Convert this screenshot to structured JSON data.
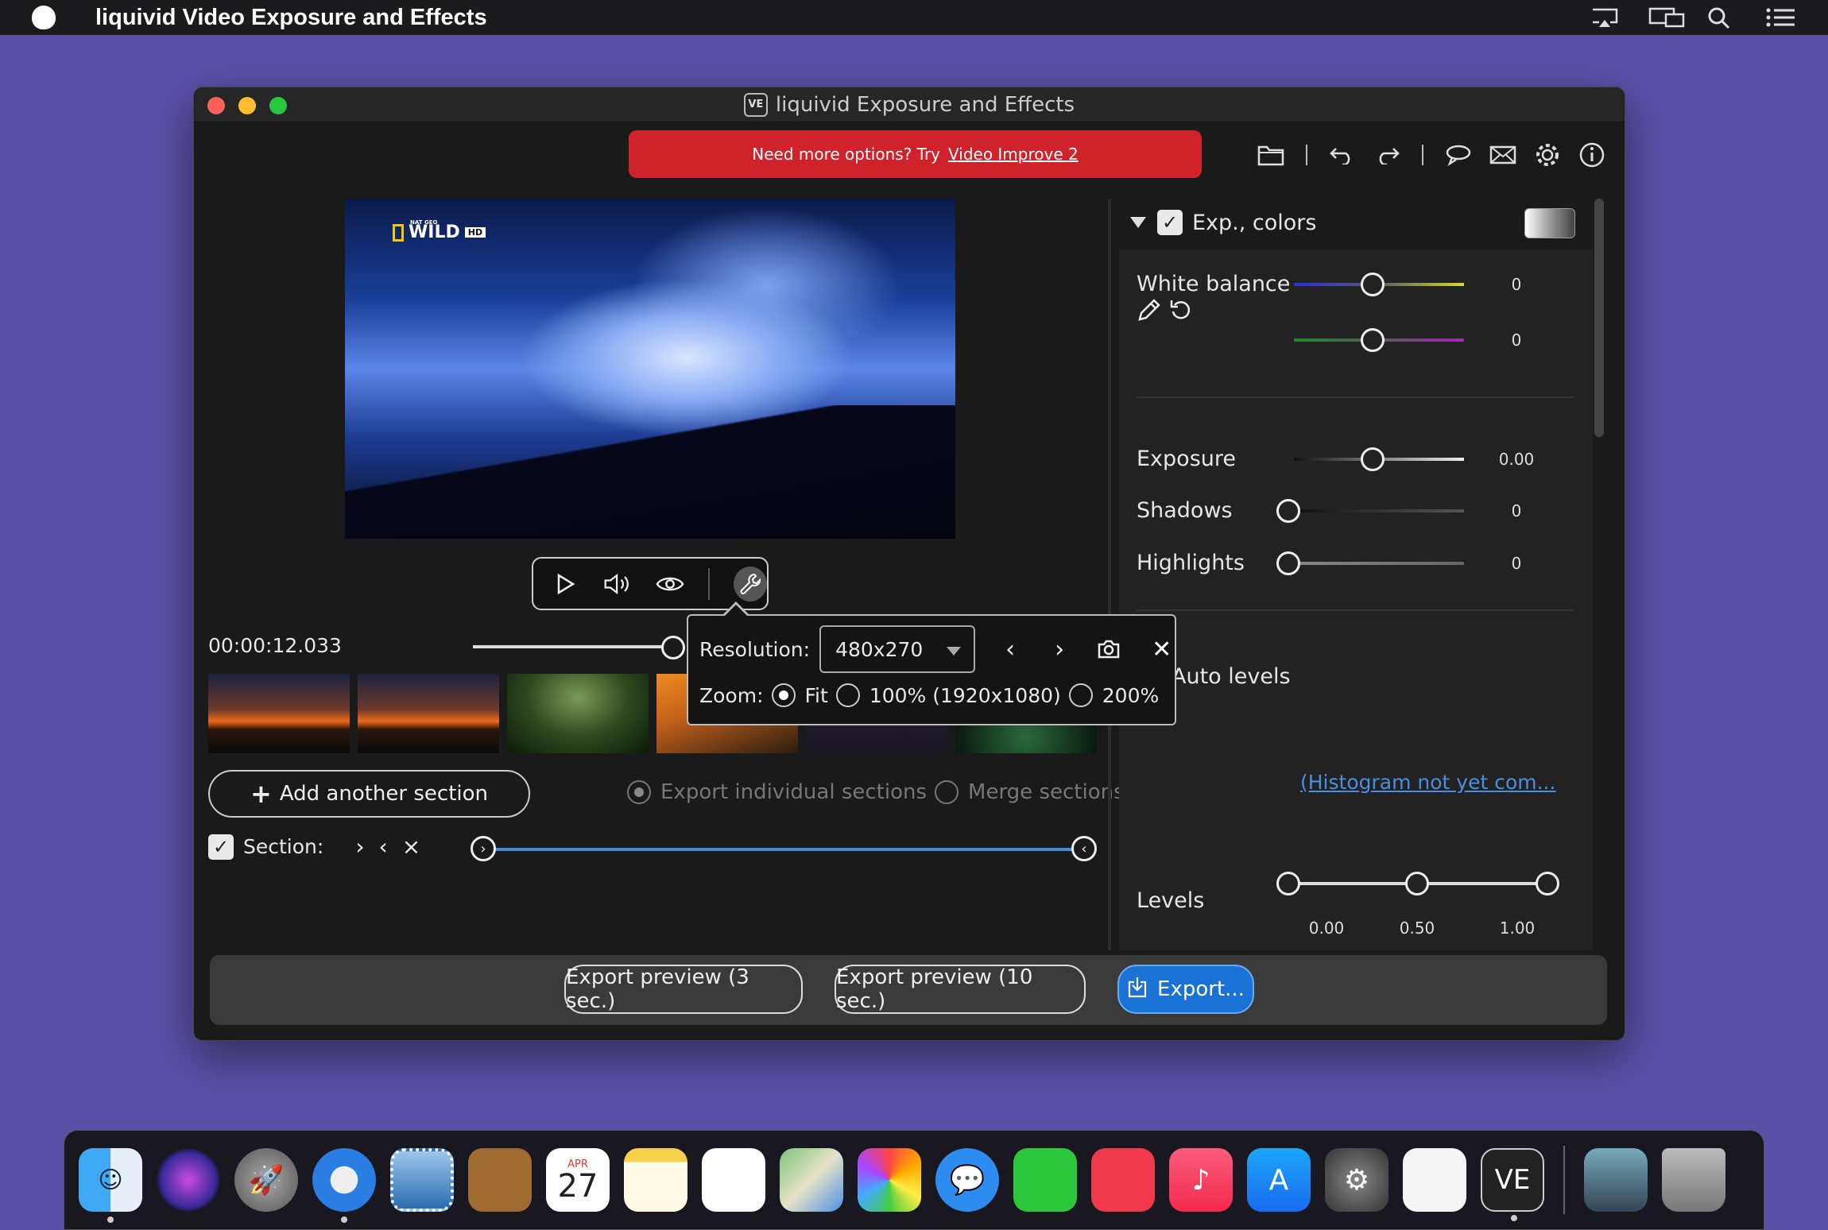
{
  "menubar": {
    "app_name": "liquivid Video Exposure and Effects",
    "icons": [
      "airplay-icon",
      "screen-mirroring-icon",
      "spotlight-search-icon",
      "notification-center-icon"
    ]
  },
  "window": {
    "title": "liquivid Exposure and Effects",
    "title_badge": "VE"
  },
  "promo": {
    "text": "Need more options? Try",
    "link": "Video Improve 2",
    "color": "#d0222a"
  },
  "toolbar": {
    "icons": [
      "open-folder-icon",
      "undo-icon",
      "redo-icon",
      "feedback-bubble-icon",
      "mail-icon",
      "settings-gear-icon",
      "info-icon"
    ]
  },
  "preview": {
    "logo_small": "NAT GEO",
    "logo_main": "WILD",
    "logo_hd": "HD"
  },
  "player": {
    "time": "00:00:12.033",
    "icons": [
      "play-icon",
      "volume-icon",
      "eye-icon",
      "wrench-icon"
    ]
  },
  "resolution_popover": {
    "resolution_label": "Resolution:",
    "resolution_value": "480x270",
    "zoom_label": "Zoom:",
    "zoom_options": [
      "Fit",
      "100% (1920x1080)",
      "200%"
    ],
    "zoom_selected": "Fit"
  },
  "sections": {
    "add_button": "Add another section",
    "export_individual": "Export individual sections",
    "merge": "Merge sections",
    "section_label": "Section:",
    "accent": "#3b8ed9"
  },
  "panel": {
    "header": "Exp., colors",
    "white_balance": {
      "label": "White balance",
      "value1": "0",
      "value2": "0"
    },
    "exposure": {
      "label": "Exposure",
      "value": "0.00"
    },
    "shadows": {
      "label": "Shadows",
      "value": "0"
    },
    "highlights": {
      "label": "Highlights",
      "value": "0"
    },
    "auto_levels": "Auto levels",
    "histogram_link": "(Histogram not yet com...",
    "levels": {
      "label": "Levels",
      "low": "0.00",
      "mid": "0.50",
      "high": "1.00"
    }
  },
  "bottom": {
    "export_preview_3": "Export preview (3 sec.)",
    "export_preview_10": "Export preview (10 sec.)",
    "export": "Export...",
    "primary_color": "#1b72d6"
  },
  "dock": {
    "icons": [
      "finder-icon",
      "siri-icon",
      "launchpad-icon",
      "safari-icon",
      "mail-stamp-icon",
      "contacts-icon",
      "calendar-icon",
      "notes-icon",
      "reminders-icon",
      "maps-icon",
      "photos-icon",
      "messages-icon",
      "facetime-icon",
      "news-icon",
      "music-icon",
      "app-store-icon",
      "system-preferences-icon",
      "textedit-icon",
      "liquivid-ve-icon",
      "downloads-stack-icon",
      "trash-icon"
    ],
    "calendar_month": "APR",
    "calendar_day": "27",
    "ve_label": "VE"
  }
}
